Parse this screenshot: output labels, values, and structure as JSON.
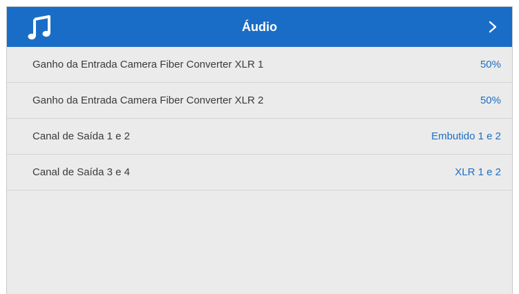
{
  "header": {
    "title": "Áudio",
    "icon": "music-note-icon",
    "nav_icon": "chevron-right-icon"
  },
  "rows": [
    {
      "label": "Ganho da Entrada Camera Fiber Converter XLR 1",
      "value": "50%"
    },
    {
      "label": "Ganho da Entrada Camera Fiber Converter XLR 2",
      "value": "50%"
    },
    {
      "label": "Canal de Saída 1 e 2",
      "value": "Embutido 1 e 2"
    },
    {
      "label": "Canal de Saída 3 e 4",
      "value": "XLR 1 e 2"
    }
  ],
  "colors": {
    "header_bg": "#1a6dc6",
    "value_text": "#1b6ec2",
    "panel_bg": "#ebebeb"
  }
}
